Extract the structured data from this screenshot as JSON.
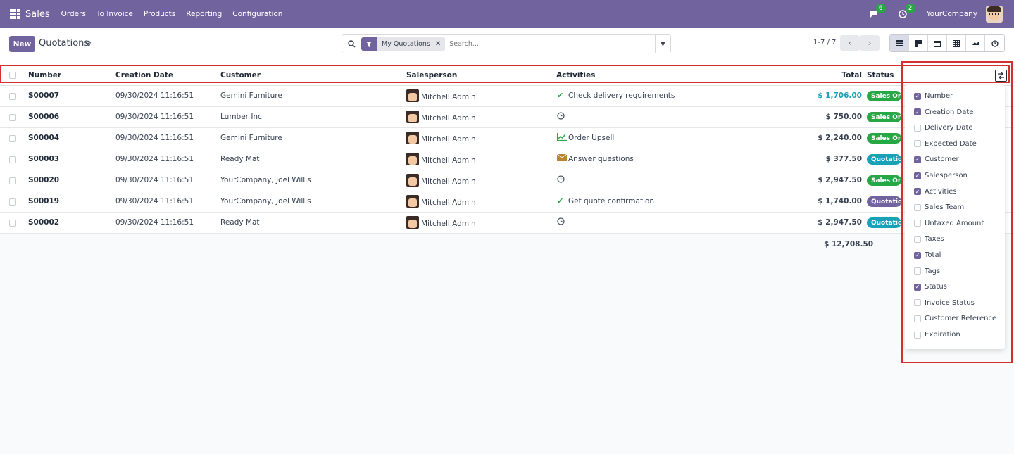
{
  "navbar": {
    "brand": "Sales",
    "menu": [
      "Orders",
      "To Invoice",
      "Products",
      "Reporting",
      "Configuration"
    ],
    "messages_count": "6",
    "activities_count": "2",
    "company": "YourCompany"
  },
  "control": {
    "new_label": "New",
    "title": "Quotations",
    "facet_label": "My Quotations",
    "search_placeholder": "Search...",
    "pager": "1-7 / 7"
  },
  "table": {
    "headers": {
      "number": "Number",
      "creation_date": "Creation Date",
      "customer": "Customer",
      "salesperson": "Salesperson",
      "activities": "Activities",
      "total": "Total",
      "status": "Status"
    },
    "rows": [
      {
        "number": "S00007",
        "date": "09/30/2024 11:16:51",
        "customer": "Gemini Furniture",
        "salesperson": "Mitchell Admin",
        "activity_icon": "check-icon",
        "activity": "Check delivery requirements",
        "total": "$ 1,706.00",
        "status": "Sales Order"
      },
      {
        "number": "S00006",
        "date": "09/30/2024 11:16:51",
        "customer": "Lumber Inc",
        "salesperson": "Mitchell Admin",
        "activity_icon": "clock-icon",
        "activity": "",
        "total": "$ 750.00",
        "status": "Sales Order"
      },
      {
        "number": "S00004",
        "date": "09/30/2024 11:16:51",
        "customer": "Gemini Furniture",
        "salesperson": "Mitchell Admin",
        "activity_icon": "chart-icon",
        "activity": "Order Upsell",
        "total": "$ 2,240.00",
        "status": "Sales Order"
      },
      {
        "number": "S00003",
        "date": "09/30/2024 11:16:51",
        "customer": "Ready Mat",
        "salesperson": "Mitchell Admin",
        "activity_icon": "envelope-icon",
        "activity": "Answer questions",
        "total": "$ 377.50",
        "status": "Quotation"
      },
      {
        "number": "S00020",
        "date": "09/30/2024 11:16:51",
        "customer": "YourCompany, Joel Willis",
        "salesperson": "Mitchell Admin",
        "activity_icon": "clock-icon",
        "activity": "",
        "total": "$ 2,947.50",
        "status": "Sales Order"
      },
      {
        "number": "S00019",
        "date": "09/30/2024 11:16:51",
        "customer": "YourCompany, Joel Willis",
        "salesperson": "Mitchell Admin",
        "activity_icon": "check-icon",
        "activity": "Get quote confirmation",
        "total": "$ 1,740.00",
        "status": "Quotation Sent"
      },
      {
        "number": "S00002",
        "date": "09/30/2024 11:16:51",
        "customer": "Ready Mat",
        "salesperson": "Mitchell Admin",
        "activity_icon": "clock-icon",
        "activity": "",
        "total": "$ 2,947.50",
        "status": "Quotation"
      }
    ],
    "grand_total": "$ 12,708.50"
  },
  "optional_columns": [
    {
      "label": "Number",
      "checked": true
    },
    {
      "label": "Creation Date",
      "checked": true
    },
    {
      "label": "Delivery Date",
      "checked": false
    },
    {
      "label": "Expected Date",
      "checked": false
    },
    {
      "label": "Customer",
      "checked": true
    },
    {
      "label": "Salesperson",
      "checked": true
    },
    {
      "label": "Activities",
      "checked": true
    },
    {
      "label": "Sales Team",
      "checked": false
    },
    {
      "label": "Untaxed Amount",
      "checked": false
    },
    {
      "label": "Taxes",
      "checked": false
    },
    {
      "label": "Total",
      "checked": true
    },
    {
      "label": "Tags",
      "checked": false
    },
    {
      "label": "Status",
      "checked": true
    },
    {
      "label": "Invoice Status",
      "checked": false
    },
    {
      "label": "Customer Reference",
      "checked": false
    },
    {
      "label": "Expiration",
      "checked": false
    }
  ],
  "colors": {
    "brand": "#71639e",
    "sales_order": "#28a745",
    "quotation": "#17a2b8",
    "quotation_sent": "#71639e",
    "highlight": "#d32f2f"
  }
}
